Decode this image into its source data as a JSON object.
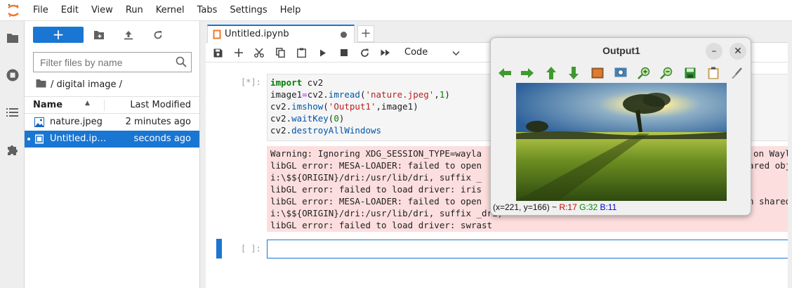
{
  "menubar": {
    "items": [
      "File",
      "Edit",
      "View",
      "Run",
      "Kernel",
      "Tabs",
      "Settings",
      "Help"
    ]
  },
  "filebrowser": {
    "new_label": "+",
    "filter_placeholder": "Filter files by name",
    "breadcrumb": "/ digital image /",
    "columns": {
      "name": "Name",
      "modified": "Last Modified"
    },
    "files": [
      {
        "name": "nature.jpeg",
        "modified": "2 minutes ago",
        "icon": "image-file-icon",
        "selected": false
      },
      {
        "name": "Untitled.ip…",
        "modified": "seconds ago",
        "icon": "notebook-file-icon",
        "selected": true
      }
    ]
  },
  "notebook": {
    "tab_title": "Untitled.ipynb",
    "cell_type": "Code",
    "cell1": {
      "prompt": "[*]:",
      "code": [
        "import cv2",
        "image1=cv2.imread('nature.jpeg',1)",
        "cv2.imshow('Output1',image1)",
        "cv2.waitKey(0)",
        "cv2.destroyAllWindows"
      ],
      "output": [
        "Warning: Ignoring XDG_SESSION_TYPE=wayla",
        "libGL error: MESA-LOADER: failed to open",
        "i:\\$${ORIGIN}/dri:/usr/lib/dri, suffix _",
        "libGL error: failed to load driver: iris",
        "libGL error: MESA-LOADER: failed to open",
        "i:\\$${ORIGIN}/dri:/usr/lib/dri, suffix _dri)",
        "libGL error: failed to load driver: swrast"
      ],
      "output_right": [
        "on Wayl",
        "ared obj",
        "",
        "",
        "n shared",
        "",
        ""
      ]
    },
    "cell2": {
      "prompt": "[ ]:"
    }
  },
  "cv_window": {
    "title": "Output1",
    "minimize": "–",
    "close": "✕",
    "status_coords": "(x=221, y=166) ~ ",
    "status_r": "R:17",
    "status_g": "G:32",
    "status_b": "B:11",
    "tools": [
      "pan-left-icon",
      "pan-right-icon",
      "pan-up-icon",
      "pan-down-icon",
      "zoom-image-icon",
      "zoom-fit-icon",
      "zoom-in-icon",
      "zoom-out-icon",
      "save-icon",
      "copy-icon",
      "properties-icon"
    ]
  },
  "colors": {
    "accent": "#1976d2",
    "error_bg": "#fddede"
  }
}
